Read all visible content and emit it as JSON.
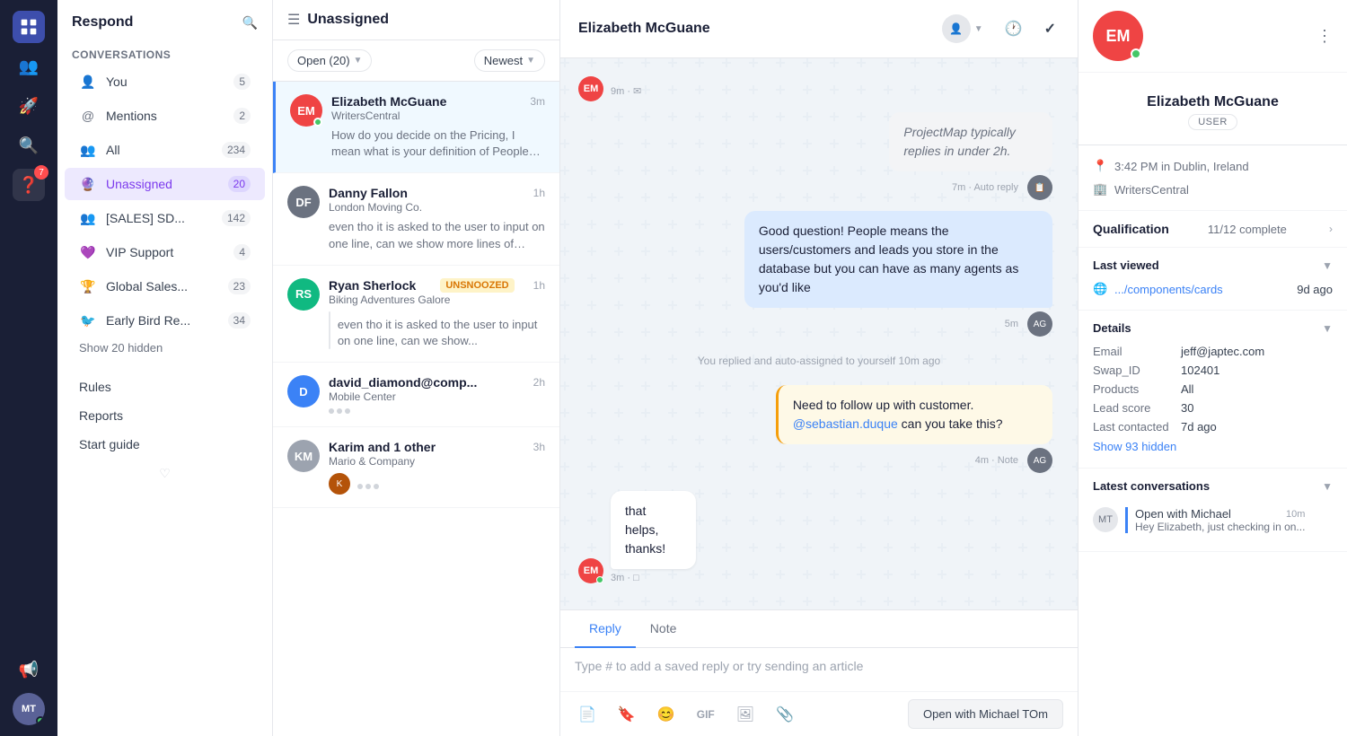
{
  "app": {
    "title": "Respond"
  },
  "nav_sidebar": {
    "title": "Respond",
    "conversations_label": "Conversations",
    "items": [
      {
        "id": "you",
        "label": "You",
        "count": "5",
        "icon": "👤"
      },
      {
        "id": "mentions",
        "label": "Mentions",
        "count": "2",
        "icon": "@"
      },
      {
        "id": "all",
        "label": "All",
        "count": "234",
        "icon": "👥"
      },
      {
        "id": "unassigned",
        "label": "Unassigned",
        "count": "20",
        "icon": "🔮",
        "active": true
      },
      {
        "id": "sales",
        "label": "[SALES] SD...",
        "count": "142",
        "icon": "👥"
      },
      {
        "id": "vip",
        "label": "VIP Support",
        "count": "4",
        "icon": "💜"
      },
      {
        "id": "global",
        "label": "Global Sales...",
        "count": "23",
        "icon": "🏆"
      },
      {
        "id": "earlybird",
        "label": "Early Bird Re...",
        "count": "34",
        "icon": "🐦"
      }
    ],
    "show_hidden": "Show 20 hidden",
    "rules": "Rules",
    "reports": "Reports",
    "start_guide": "Start guide"
  },
  "conv_list": {
    "header_title": "Unassigned",
    "filter_open": "Open (20)",
    "filter_newest": "Newest",
    "conversations": [
      {
        "id": "c1",
        "name": "Elizabeth McGuane",
        "company": "WritersCentral",
        "time": "3m",
        "preview": "How do you decide on the Pricing, I mean what is your definition of People? When...",
        "avatar_text": "EM",
        "avatar_bg": "#ef4444",
        "online": true,
        "active": true
      },
      {
        "id": "c2",
        "name": "Danny Fallon",
        "company": "London Moving Co.",
        "time": "1h",
        "preview": "even tho it is asked to the user to input on one line, can we show more lines of text...",
        "avatar_url": true,
        "avatar_bg": "#6b7280",
        "online": false,
        "active": false
      },
      {
        "id": "c3",
        "name": "Ryan Sherlock",
        "company": "Biking Adventures Galore",
        "time": "1h",
        "badge": "UNSNOOZED",
        "preview": "even tho it is asked to the user to input on one line, can we show...",
        "avatar_text": "RS",
        "avatar_bg": "#10b981",
        "online": false,
        "active": false
      },
      {
        "id": "c4",
        "name": "david_diamond@comp...",
        "company": "Mobile Center",
        "time": "2h",
        "preview": "",
        "avatar_text": "D",
        "avatar_bg": "#3b82f6",
        "online": false,
        "active": false,
        "has_dots": true
      },
      {
        "id": "c5",
        "name": "Karim and 1 other",
        "company": "Mario & Company",
        "time": "3h",
        "preview": "",
        "avatar_url": true,
        "avatar_bg": "#6b7280",
        "online": false,
        "active": false,
        "has_dots": true,
        "has_sub_avatar": true
      }
    ]
  },
  "chat": {
    "contact_name": "Elizabeth McGuane",
    "messages": [
      {
        "id": "m1",
        "type": "incoming",
        "text": "",
        "meta": "9m · ✉",
        "has_avatar": true,
        "avatar_text": "EM",
        "avatar_bg": "#ef4444"
      },
      {
        "id": "m2",
        "type": "auto-reply",
        "text": "ProjectMap typically replies in under 2h.",
        "meta": "7m · Auto reply",
        "align": "right"
      },
      {
        "id": "m3",
        "type": "outgoing",
        "text": "Good question! People means the users/customers and leads you store in the database but you can have as many agents as you'd like",
        "meta": "5m",
        "align": "right"
      },
      {
        "id": "m4",
        "type": "system",
        "text": "You replied and auto-assigned to yourself 10m ago"
      },
      {
        "id": "m5",
        "type": "note",
        "text": "Need to follow up with customer. @sebastian.duque can you take this?",
        "meta": "4m · Note",
        "align": "right",
        "mention": "@sebastian.duque"
      },
      {
        "id": "m6",
        "type": "incoming",
        "text": "that helps, thanks!",
        "meta": "3m · □",
        "has_avatar": true,
        "avatar_text": "EM",
        "avatar_bg": "#ef4444"
      }
    ],
    "reply_tab": "Reply",
    "note_tab": "Note",
    "reply_placeholder": "Type # to add a saved reply or try sending an article",
    "open_with_button": "Open with Michael TOm"
  },
  "contact": {
    "name": "Elizabeth McGuane",
    "initials": "EM",
    "avatar_bg": "#ef4444",
    "badge": "USER",
    "local_time": "3:42 PM in Dublin, Ireland",
    "company": "WritersCentral",
    "qualification_label": "Qualification",
    "qualification_value": "11/12 complete",
    "last_viewed_label": "Last viewed",
    "last_viewed_url": ".../components/cards",
    "last_viewed_time": "9d ago",
    "details_label": "Details",
    "email_label": "Email",
    "email_value": "jeff@japtec.com",
    "swap_id_label": "Swap_ID",
    "swap_id_value": "102401",
    "products_label": "Products",
    "products_value": "All",
    "lead_score_label": "Lead score",
    "lead_score_value": "30",
    "last_contacted_label": "Last contacted",
    "last_contacted_value": "7d ago",
    "show_hidden": "Show 93 hidden",
    "latest_conversations_label": "Latest conversations",
    "latest_conv": {
      "title": "Open with Michael",
      "time": "10m",
      "preview": "Hey Elizabeth, just checking in on..."
    }
  }
}
